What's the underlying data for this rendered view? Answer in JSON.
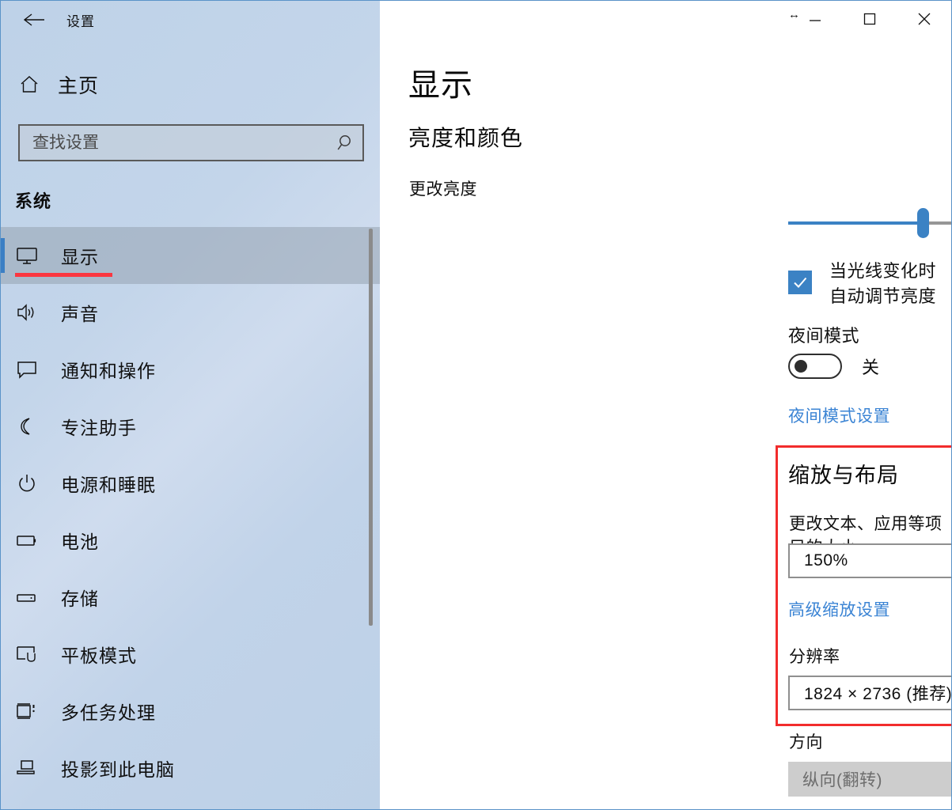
{
  "window": {
    "app_title": "设置",
    "back_icon": "back-arrow-icon",
    "controls": {
      "resize_cursor": "↔",
      "minimize_label": "—",
      "maximize_label": "□",
      "close_label": "✕"
    }
  },
  "sidebar": {
    "home_label": "主页",
    "home_icon": "home-icon",
    "search": {
      "value": "",
      "placeholder": "查找设置",
      "icon": "search-icon"
    },
    "section_title": "系统",
    "items": [
      {
        "label": "显示",
        "icon": "monitor-icon",
        "selected": true
      },
      {
        "label": "声音",
        "icon": "speaker-icon",
        "selected": false
      },
      {
        "label": "通知和操作",
        "icon": "notification-icon",
        "selected": false
      },
      {
        "label": "专注助手",
        "icon": "moon-icon",
        "selected": false
      },
      {
        "label": "电源和睡眠",
        "icon": "power-icon",
        "selected": false
      },
      {
        "label": "电池",
        "icon": "battery-icon",
        "selected": false
      },
      {
        "label": "存储",
        "icon": "storage-icon",
        "selected": false
      },
      {
        "label": "平板模式",
        "icon": "tablet-icon",
        "selected": false
      },
      {
        "label": "多任务处理",
        "icon": "multitask-icon",
        "selected": false
      },
      {
        "label": "投影到此电脑",
        "icon": "project-icon",
        "selected": false
      }
    ]
  },
  "main": {
    "page_title": "显示",
    "brightness_section": {
      "heading": "亮度和颜色",
      "slider_label": "更改亮度",
      "slider_value_percent": 40,
      "auto_brightness_label": "当光线变化时自动调节亮度",
      "auto_brightness_checked": true
    },
    "night_light": {
      "label": "夜间模式",
      "toggle_state": "关",
      "toggle_on": false,
      "settings_link": "夜间模式设置"
    },
    "scale_layout": {
      "heading": "缩放与布局",
      "scale_label": "更改文本、应用等项目的大小",
      "scale_value": "150%",
      "advanced_link": "高级缩放设置",
      "resolution_label": "分辨率",
      "resolution_value": "1824 × 2736 (推荐)"
    },
    "orientation": {
      "label": "方向",
      "value": "纵向(翻转)",
      "disabled": true
    }
  },
  "colors": {
    "accent_blue": "#3b82c4",
    "link_blue": "#3b84d4",
    "annotation_red": "#f22c2c",
    "sidebar_blue": "#bed2e8",
    "selected_gray": "#96a3b0"
  }
}
